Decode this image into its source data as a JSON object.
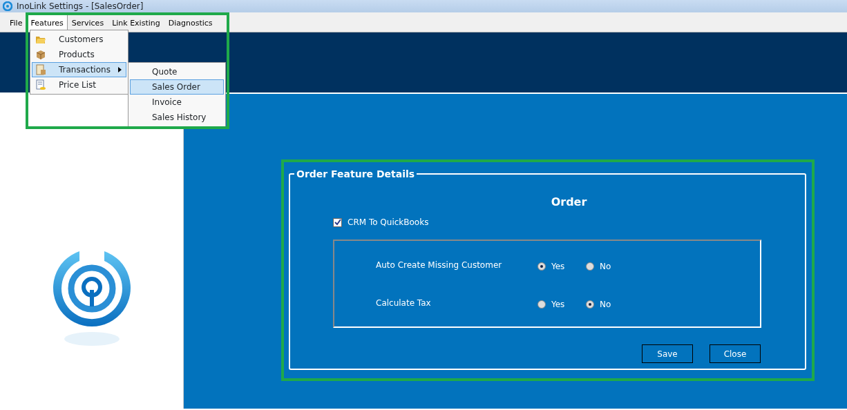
{
  "window": {
    "title": "InoLink Settings - [SalesOrder]"
  },
  "menu_bar": [
    {
      "label": "File",
      "selected": false
    },
    {
      "label": "Features",
      "selected": true
    },
    {
      "label": "Services",
      "selected": false
    },
    {
      "label": "Link Existing",
      "selected": false
    },
    {
      "label": "Diagnostics",
      "selected": false
    }
  ],
  "features_menu": [
    {
      "label": "Customers",
      "has_submenu": false,
      "highlighted": false
    },
    {
      "label": "Products",
      "has_submenu": false,
      "highlighted": false
    },
    {
      "label": "Transactions",
      "has_submenu": true,
      "highlighted": true
    },
    {
      "label": "Price List",
      "has_submenu": false,
      "highlighted": false
    }
  ],
  "transactions_submenu": [
    {
      "label": "Quote",
      "selected": false
    },
    {
      "label": "Sales Order",
      "selected": true
    },
    {
      "label": "Invoice",
      "selected": false
    },
    {
      "label": "Sales History",
      "selected": false
    }
  ],
  "group": {
    "title": "Order Feature Details",
    "heading": "Order",
    "checkbox": {
      "label": "CRM To QuickBooks",
      "checked": true
    },
    "options": [
      {
        "label": "Auto Create Missing Customer",
        "choices": [
          {
            "label": "Yes",
            "selected": true
          },
          {
            "label": "No",
            "selected": false
          }
        ]
      },
      {
        "label": "Calculate Tax",
        "choices": [
          {
            "label": "Yes",
            "selected": false
          },
          {
            "label": "No",
            "selected": true
          }
        ]
      }
    ],
    "buttons": [
      "Save",
      "Close"
    ]
  }
}
